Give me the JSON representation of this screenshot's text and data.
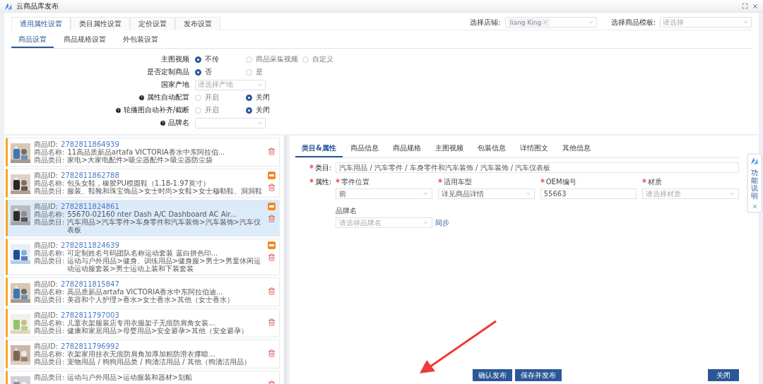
{
  "window": {
    "title": "云商品库发布"
  },
  "main_tabs": [
    {
      "label": "通用属性设置",
      "selected": true
    },
    {
      "label": "类目属性设置",
      "selected": false
    },
    {
      "label": "定价设置",
      "selected": false
    },
    {
      "label": "发布设置",
      "selected": false
    }
  ],
  "store_select": {
    "label": "选择店铺:",
    "tag": "liang King"
  },
  "template_select": {
    "label": "选择商品模板:",
    "placeholder": "请选择"
  },
  "sub_tabs": [
    {
      "label": "商品设置",
      "selected": true
    },
    {
      "label": "商品规格设置",
      "selected": false
    },
    {
      "label": "外包装设置",
      "selected": false
    }
  ],
  "settings": [
    {
      "kind": "radio",
      "label": "主图视频",
      "help": false,
      "options": [
        {
          "label": "不传",
          "selected": true
        },
        {
          "label": "商品采集视频",
          "selected": false
        },
        {
          "label": "自定义",
          "selected": false
        }
      ]
    },
    {
      "kind": "radio",
      "label": "是否定制商品",
      "help": false,
      "options": [
        {
          "label": "否",
          "selected": true
        },
        {
          "label": "是",
          "selected": false
        }
      ]
    },
    {
      "kind": "select",
      "label": "国家产地",
      "help": false,
      "placeholder": "请选择产地"
    },
    {
      "kind": "radio",
      "label": "属性自动配置",
      "help": true,
      "options": [
        {
          "label": "开启",
          "selected": false
        },
        {
          "label": "关闭",
          "selected": true
        }
      ]
    },
    {
      "kind": "radio",
      "label": "轮播图自动补齐/截断",
      "help": true,
      "options": [
        {
          "label": "开启",
          "selected": false
        },
        {
          "label": "关闭",
          "selected": true
        }
      ]
    },
    {
      "kind": "select",
      "label": "品牌名",
      "help": true
    }
  ],
  "products": [
    {
      "id_label": "商品ID:",
      "id": "2782811864939",
      "name_label": "商品名称:",
      "name": "11高品质新品artafa VICTORIA香水中东阿拉伯...",
      "category_label": "商品类目:",
      "category": "家电>大家电配件>吸尘器配件>吸尘器防尘袋",
      "badge": false,
      "selected": false
    },
    {
      "id_label": "商品ID:",
      "id": "2782811862788",
      "name_label": "商品名称:",
      "name": "包头女鞋，橡胶PU模圆鞋（1.18-1.97英寸）",
      "category_label": "商品类目:",
      "category": "服装、鞋靴和珠宝饰品>女士时尚>女鞋>女士穆勒鞋、洞洞鞋",
      "badge": true,
      "selected": false
    },
    {
      "id_label": "商品ID:",
      "id": "2782811824861",
      "name_label": "商品名称:",
      "name": "55670-02160 nter Dash A/C Dashboard AC Air...",
      "category_label": "商品类目:",
      "category": "汽车用品>汽车零件>车身零件和汽车装饰>汽车装饰>汽车仪表板",
      "badge": true,
      "selected": true
    },
    {
      "id_label": "商品ID:",
      "id": "2782811824639",
      "name_label": "商品名称:",
      "name": "可定制姓名号码团队名称运动套装 蓝白拼色印...",
      "category_label": "商品类目:",
      "category": "运动与户外用品>健身、训练用品>健身服>男士>男童休闲运动运动服套装>男士运动上装和下装套装",
      "badge": true,
      "selected": false
    },
    {
      "id_label": "商品ID:",
      "id": "2782811815847",
      "name_label": "商品名称:",
      "name": "高品质新品artafa VICTORIA香水中东阿拉伯迪...",
      "category_label": "商品类目:",
      "category": "美容和个人护理>香水>女士香水>其他（女士香水）",
      "badge": false,
      "selected": false
    },
    {
      "id_label": "商品ID:",
      "id": "2782811797003",
      "name_label": "商品名称:",
      "name": "儿童衣架服装店专用衣服架子无痕防肩角女装...",
      "category_label": "商品类目:",
      "category": "健康和家居用品>母婴用品>安全避孕>其他（安全避孕）",
      "badge": false,
      "selected": false
    },
    {
      "id_label": "商品ID:",
      "id": "2782811796992",
      "name_label": "商品名称:",
      "name": "衣架家用挂衣无痕防肩角加厚加粗防滑衣撑晾...",
      "category_label": "商品类目:",
      "category": "宠物用品 / 狗狗用品类 / 狗清洁用品 / 其他（狗清洁用品）",
      "badge": false,
      "selected": false
    },
    {
      "category_label": "商品类目:",
      "category": "运动与户外用品>运动服装和器材>划船",
      "badge": false,
      "selected": false
    }
  ],
  "detail_tabs": [
    {
      "label": "类目&属性",
      "selected": true
    },
    {
      "label": "商品信息",
      "selected": false
    },
    {
      "label": "商品规格",
      "selected": false
    },
    {
      "label": "主图视频",
      "selected": false
    },
    {
      "label": "包装信息",
      "selected": false
    },
    {
      "label": "详情图文",
      "selected": false
    },
    {
      "label": "其他信息",
      "selected": false
    }
  ],
  "category": {
    "required": true,
    "label": "类目:",
    "value": "汽车用品 / 汽车零件 / 车身零件和汽车装饰 / 汽车装饰 / 汽车仪表板"
  },
  "attributes": {
    "required": true,
    "label": "属性:",
    "fields": [
      {
        "kind": "select",
        "label": "零件位置",
        "required": true,
        "value": "前"
      },
      {
        "kind": "select",
        "label": "适用车型",
        "required": true,
        "value": "详见商品详情"
      },
      {
        "kind": "input",
        "label": "OEM编号",
        "required": true,
        "value": "55663"
      },
      {
        "kind": "select",
        "label": "材质",
        "required": true,
        "placeholder": "请选择材质"
      },
      {
        "kind": "select",
        "label": "品牌名",
        "required": false,
        "placeholder": "请选择品牌名",
        "link": "同步"
      }
    ]
  },
  "help_panel": {
    "label": "功能说明"
  },
  "buttons": {
    "confirm": "确认发布",
    "save_publish": "保存并发布",
    "close": "关闭"
  }
}
